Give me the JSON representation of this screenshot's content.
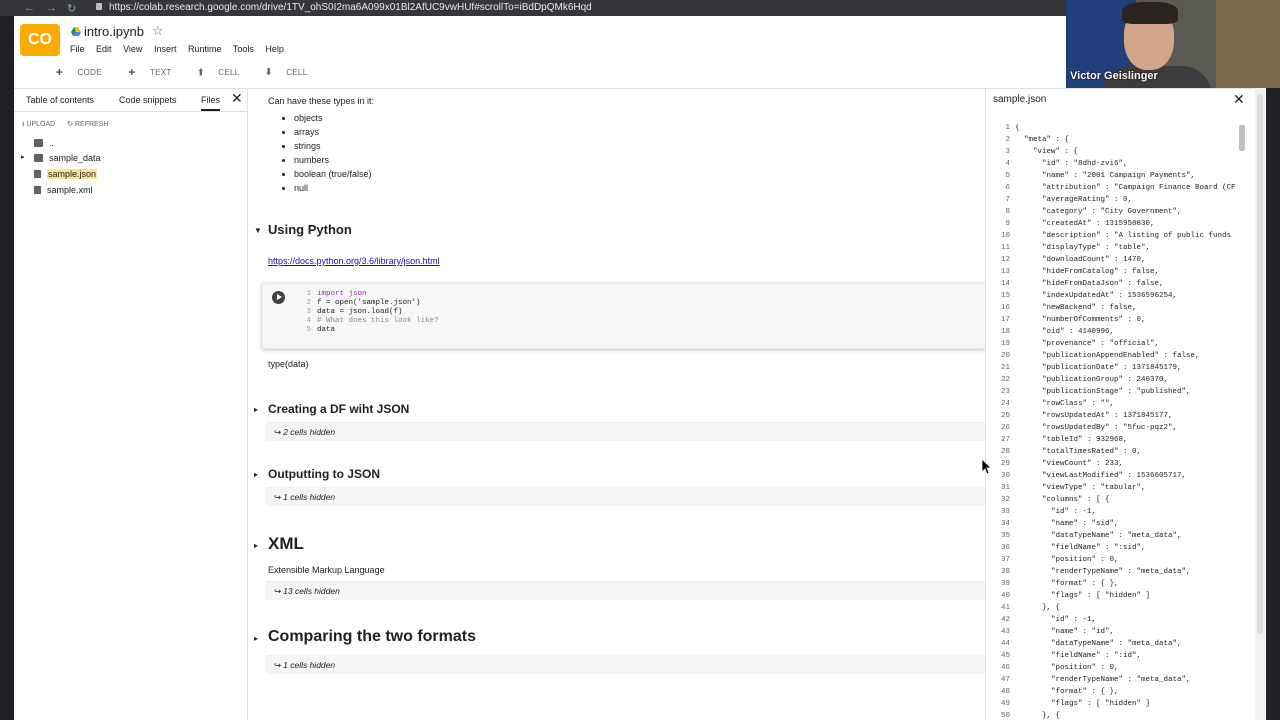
{
  "browser": {
    "url": "https://colab.research.google.com/drive/1TV_ohS0I2ma6A099x01Bl2AfUC9vwHUf#scrollTo=iBdDpQMk6Hqd"
  },
  "header": {
    "logo": "CO",
    "notebook_title": "intro.ipynb",
    "menu": [
      "File",
      "Edit",
      "View",
      "Insert",
      "Runtime",
      "Tools",
      "Help"
    ],
    "toolbar": [
      "CODE",
      "TEXT",
      "CELL",
      "CELL"
    ]
  },
  "sidebar": {
    "tabs": [
      "Table of contents",
      "Code snippets",
      "Files"
    ],
    "actions": [
      "UPLOAD",
      "REFRESH"
    ],
    "files": [
      "..",
      "sample_data",
      "sample.json",
      "sample.xml"
    ]
  },
  "main": {
    "intro_text": "Can have these types in it:",
    "bullets": [
      "objects",
      "arrays",
      "strings",
      "numbers",
      "boolean (true/false)",
      "null"
    ],
    "python_heading": "Using Python",
    "python_link": "https://docs.python.org/3.6/library/json.html",
    "code_lines": [
      "import json",
      "f = open('sample.json')",
      "data = json.load(f)",
      "# What does this look like?",
      "data"
    ],
    "type_text": "type(data)",
    "df_heading": "Creating a DF wiht JSON",
    "df_hidden": "2 cells hidden",
    "out_heading": "Outputting to JSON",
    "out_hidden": "1 cells hidden",
    "xml_heading": "XML",
    "xml_text": "Extensible Markup Language",
    "xml_hidden": "13 cells hidden",
    "cmp_heading": "Comparing the two formats",
    "cmp_hidden": "1 cells hidden"
  },
  "viewer": {
    "title": "sample.json",
    "lines": [
      "{",
      "  \"meta\" : {",
      "    \"view\" : {",
      "      \"id\" : \"8dhd-zvi6\",",
      "      \"name\" : \"2001 Campaign Payments\",",
      "      \"attribution\" : \"Campaign Finance Board (CF",
      "      \"averageRating\" : 0,",
      "      \"category\" : \"City Government\",",
      "      \"createdAt\" : 1315950830,",
      "      \"description\" : \"A listing of public funds",
      "      \"displayType\" : \"table\",",
      "      \"downloadCount\" : 1470,",
      "      \"hideFromCatalog\" : false,",
      "      \"hideFromDataJson\" : false,",
      "      \"indexUpdatedAt\" : 1536596254,",
      "      \"newBackend\" : false,",
      "      \"numberOfComments\" : 0,",
      "      \"oid\" : 4140996,",
      "      \"provenance\" : \"official\",",
      "      \"publicationAppendEnabled\" : false,",
      "      \"publicationDate\" : 1371845179,",
      "      \"publicationGroup\" : 240370,",
      "      \"publicationStage\" : \"published\",",
      "      \"rowClass\" : \"\",",
      "      \"rowsUpdatedAt\" : 1371845177,",
      "      \"rowsUpdatedBy\" : \"5fuc-pqz2\",",
      "      \"tableId\" : 932968,",
      "      \"totalTimesRated\" : 0,",
      "      \"viewCount\" : 233,",
      "      \"viewLastModified\" : 1536605717,",
      "      \"viewType\" : \"tabular\",",
      "      \"columns\" : [ {",
      "        \"id\" : -1,",
      "        \"name\" : \"sid\",",
      "        \"dataTypeName\" : \"meta_data\",",
      "        \"fieldName\" : \":sid\",",
      "        \"position\" : 0,",
      "        \"renderTypeName\" : \"meta_data\",",
      "        \"format\" : { },",
      "        \"flags\" : [ \"hidden\" ]",
      "      }, {",
      "        \"id\" : -1,",
      "        \"name\" : \"id\",",
      "        \"dataTypeName\" : \"meta_data\",",
      "        \"fieldName\" : \":id\",",
      "        \"position\" : 0,",
      "        \"renderTypeName\" : \"meta_data\",",
      "        \"format\" : { },",
      "        \"flags\" : [ \"hidden\" ]",
      "      }, {"
    ]
  },
  "webcam": {
    "name": "Victor Geislinger"
  }
}
